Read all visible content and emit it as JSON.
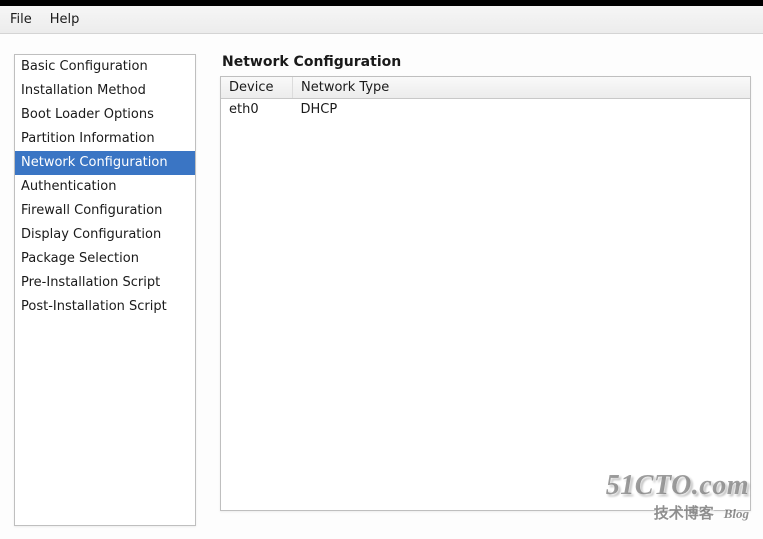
{
  "menubar": {
    "file": "File",
    "help": "Help"
  },
  "sidebar": {
    "items": [
      {
        "label": "Basic Configuration",
        "selected": false
      },
      {
        "label": "Installation Method",
        "selected": false
      },
      {
        "label": "Boot Loader Options",
        "selected": false
      },
      {
        "label": "Partition Information",
        "selected": false
      },
      {
        "label": "Network Configuration",
        "selected": true
      },
      {
        "label": "Authentication",
        "selected": false
      },
      {
        "label": "Firewall Configuration",
        "selected": false
      },
      {
        "label": "Display Configuration",
        "selected": false
      },
      {
        "label": "Package Selection",
        "selected": false
      },
      {
        "label": "Pre-Installation Script",
        "selected": false
      },
      {
        "label": "Post-Installation Script",
        "selected": false
      }
    ]
  },
  "panel": {
    "heading": "Network Configuration",
    "columns": {
      "device": "Device",
      "type": "Network Type"
    },
    "rows": [
      {
        "device": "eth0",
        "type": "DHCP"
      }
    ]
  },
  "watermark": {
    "line1": "51CTO.com",
    "line2_cn": "技术博客",
    "line2_en": "Blog"
  }
}
